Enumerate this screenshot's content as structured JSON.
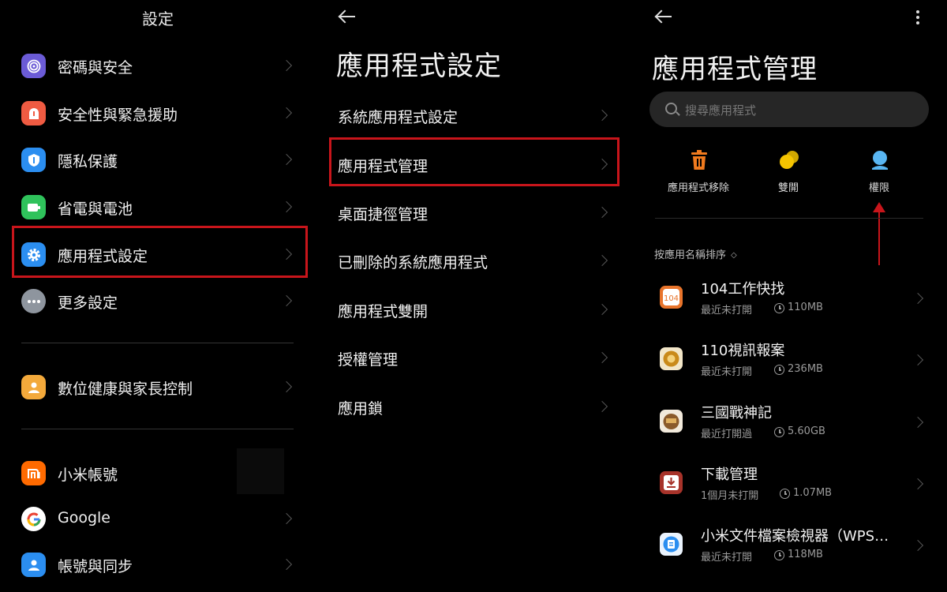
{
  "panel1": {
    "title": "設定",
    "items": [
      {
        "label": "密碼與安全",
        "icon": "fingerprint-icon",
        "color": "#6b5bd6"
      },
      {
        "label": "安全性與緊急援助",
        "icon": "emergency-icon",
        "color": "#ef5b42"
      },
      {
        "label": "隱私保護",
        "icon": "privacy-icon",
        "color": "#2b8ef0"
      },
      {
        "label": "省電與電池",
        "icon": "battery-icon",
        "color": "#2fc25b"
      },
      {
        "label": "應用程式設定",
        "icon": "gear-icon",
        "color": "#2b8ef0"
      },
      {
        "label": "更多設定",
        "icon": "more-dots-icon",
        "color": "#8e959e"
      },
      {
        "label": "數位健康與家長控制",
        "icon": "family-icon",
        "color": "#f3a93b"
      },
      {
        "label": "小米帳號",
        "icon": "mi-icon",
        "color": "#ff6a00"
      },
      {
        "label": "Google",
        "icon": "google-icon",
        "color": "#ffffff"
      },
      {
        "label": "帳號與同步",
        "icon": "account-icon",
        "color": "#2b8ef0"
      }
    ]
  },
  "panel2": {
    "title": "應用程式設定",
    "items": [
      {
        "label": "系統應用程式設定"
      },
      {
        "label": "應用程式管理"
      },
      {
        "label": "桌面捷徑管理"
      },
      {
        "label": "已刪除的系統應用程式"
      },
      {
        "label": "應用程式雙開"
      },
      {
        "label": "授權管理"
      },
      {
        "label": "應用鎖"
      }
    ]
  },
  "panel3": {
    "title": "應用程式管理",
    "search_placeholder": "搜尋應用程式",
    "tools": [
      {
        "label": "應用程式移除",
        "icon": "trash-icon",
        "color": "#f07a1e"
      },
      {
        "label": "雙開",
        "icon": "dual-apps-icon",
        "color": "#f5c400"
      },
      {
        "label": "權限",
        "icon": "permissions-icon",
        "color": "#59b6f2"
      }
    ],
    "sort_label": "按應用名稱排序",
    "apps": [
      {
        "name": "104工作快找",
        "status": "最近未打開",
        "size": "110MB",
        "icon_color": "#e8742b"
      },
      {
        "name": "110視訊報案",
        "status": "最近未打開",
        "size": "236MB",
        "icon_color": "#c98a1a"
      },
      {
        "name": "三國戰神記",
        "status": "最近打開過",
        "size": "5.60GB",
        "icon_color": "#8a5a2b"
      },
      {
        "name": "下載管理",
        "status": "1個月未打開",
        "size": "1.07MB",
        "icon_color": "#c0392b"
      },
      {
        "name": "小米文件檔案檢視器（WPS定...",
        "status": "最近未打開",
        "size": "118MB",
        "icon_color": "#2b8ef0"
      }
    ]
  }
}
